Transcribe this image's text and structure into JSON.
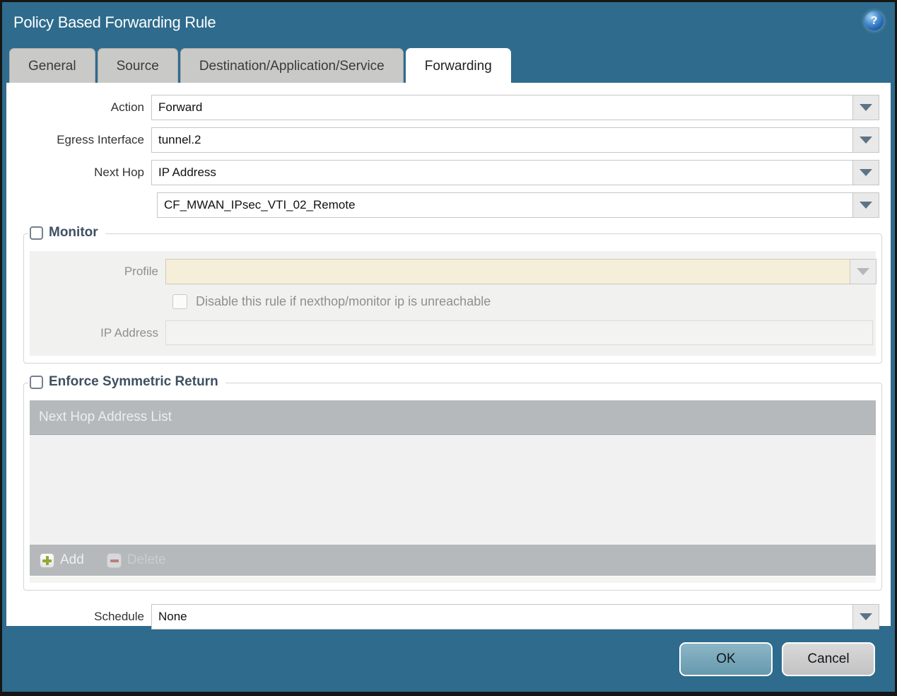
{
  "window": {
    "title": "Policy Based Forwarding Rule"
  },
  "help": {
    "glyph": "?"
  },
  "tabs": [
    {
      "label": "General",
      "active": false
    },
    {
      "label": "Source",
      "active": false
    },
    {
      "label": "Destination/Application/Service",
      "active": false
    },
    {
      "label": "Forwarding",
      "active": true
    }
  ],
  "form": {
    "action": {
      "label": "Action",
      "value": "Forward"
    },
    "egress_interface": {
      "label": "Egress Interface",
      "value": "tunnel.2"
    },
    "next_hop": {
      "label": "Next Hop",
      "value": "IP Address"
    },
    "next_hop_address": {
      "value": "CF_MWAN_IPsec_VTI_02_Remote"
    },
    "schedule": {
      "label": "Schedule",
      "value": "None"
    }
  },
  "monitor": {
    "legend": "Monitor",
    "checked": false,
    "profile": {
      "label": "Profile",
      "value": ""
    },
    "disable_rule": {
      "label": "Disable this rule if nexthop/monitor ip is unreachable",
      "checked": false
    },
    "ip_address": {
      "label": "IP Address",
      "value": ""
    }
  },
  "symmetric_return": {
    "legend": "Enforce Symmetric Return",
    "checked": false,
    "table": {
      "columns": [
        "Next Hop Address List"
      ],
      "rows": []
    },
    "add_label": "Add",
    "delete_label": "Delete"
  },
  "buttons": {
    "ok": "OK",
    "cancel": "Cancel"
  },
  "colors": {
    "titlebar": "#2e6b8d",
    "tab_inactive": "#c9cac8",
    "tab_active": "#ffffff",
    "disabled_field_cream": "#f5eed9",
    "table_bar": "#b5b9bc",
    "ok_button": "#6699ae",
    "cancel_button": "#c2c2c2",
    "add_plus": "#93a636",
    "delete_minus": "#b5837c"
  }
}
